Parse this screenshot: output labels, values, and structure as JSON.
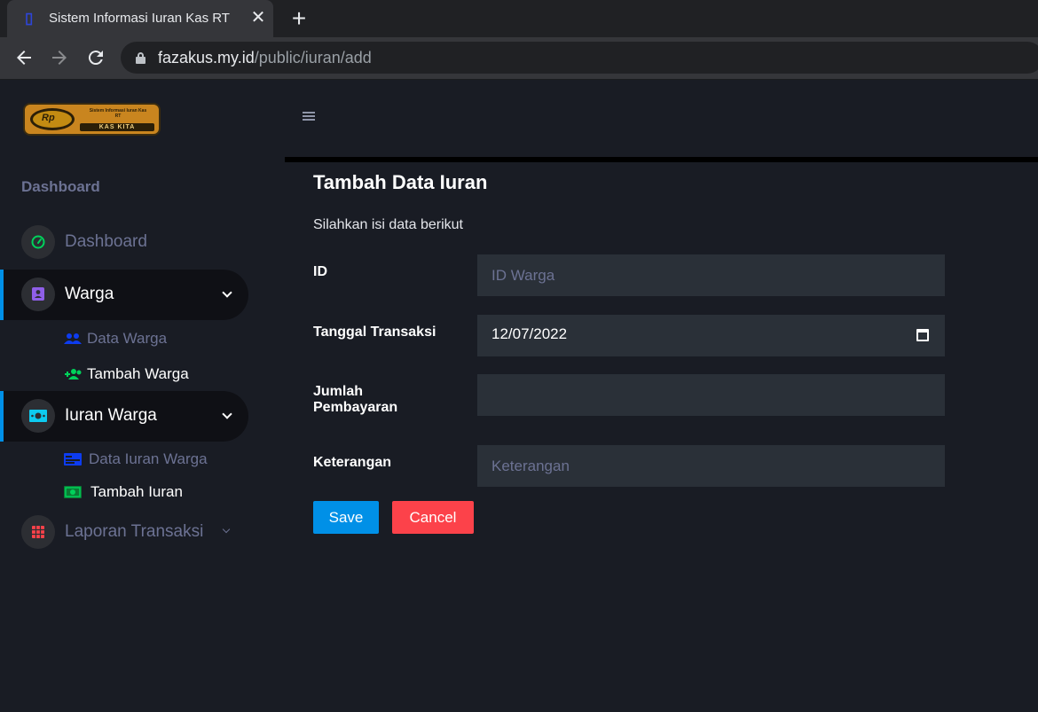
{
  "browser": {
    "tab_title": "Sistem Informasi Iuran Kas RT",
    "tab_close": "✕",
    "new_tab": "+",
    "url_host": "fazakus.my.id",
    "url_path": "/public/iuran/add"
  },
  "logo": {
    "badge": "Rp",
    "text": "Sistem Informasi Iuran Kas RT",
    "plate": "KAS KITA"
  },
  "sidebar": {
    "category": "Dashboard",
    "items": [
      {
        "label": "Dashboard",
        "icon": "speedometer-icon",
        "color": "#00d25b"
      },
      {
        "label": "Warga",
        "icon": "contact-card-icon",
        "color": "#8f5fe8"
      },
      {
        "label": "Iuran Warga",
        "icon": "cash-icon",
        "color": "#0dcaf0"
      },
      {
        "label": "Laporan Transaksi",
        "icon": "table-grid-icon",
        "color": "#fc424a"
      }
    ],
    "warga_sub": [
      {
        "label": "Data Warga",
        "icon": "users-icon",
        "color": "#0d3cf0"
      },
      {
        "label": "Tambah Warga",
        "icon": "user-add-icon",
        "color": "#00d25b"
      }
    ],
    "iuran_sub": [
      {
        "label": "Data Iuran Warga",
        "icon": "id-card-icon",
        "color": "#0d3cf0"
      },
      {
        "label": "Tambah Iuran",
        "icon": "money-bill-icon",
        "color": "#00d25b"
      }
    ]
  },
  "form": {
    "title": "Tambah Data Iuran",
    "description": "Silahkan isi data berikut",
    "id_label": "ID",
    "id_placeholder": "ID Warga",
    "date_label": "Tanggal Transaksi",
    "date_value": "12/07/2022",
    "amount_label": "Jumlah Pembayaran",
    "amount_value": "",
    "note_label": "Keterangan",
    "note_placeholder": "Keterangan",
    "save_label": "Save",
    "cancel_label": "Cancel"
  },
  "colors": {
    "primary": "#0090e7",
    "danger": "#fc424a",
    "sidebar_bg": "#191c24",
    "input_bg": "#2a3038"
  }
}
